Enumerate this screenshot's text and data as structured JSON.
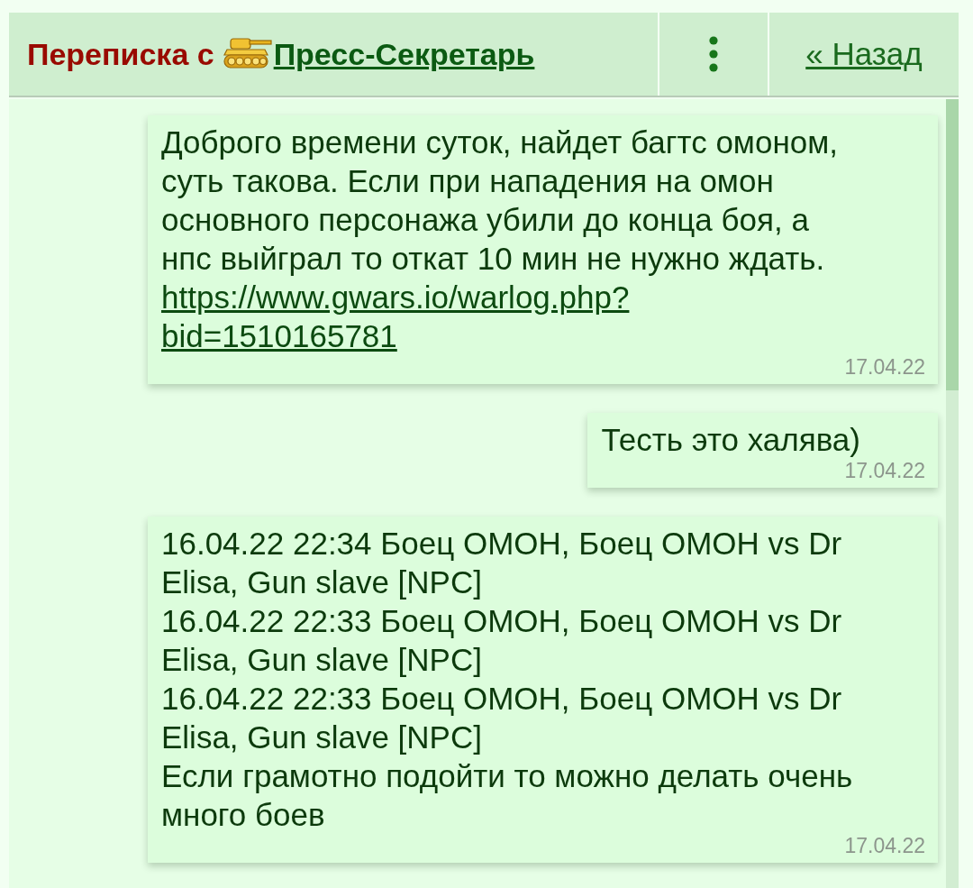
{
  "header": {
    "title": "Переписка с",
    "contact": "Пресс-Секретарь",
    "back": "« Назад"
  },
  "messages": [
    {
      "text": "Доброго времени суток, найдет багтс омоном, суть такова. Если при нападения на омон основного персонажа убили до конца боя, а нпс выйграл то откат 10 мин не нужно ждать.",
      "link": "https://www.gwars.io/warlog.php?bid=1510165781",
      "date": "17.04.22"
    },
    {
      "text": "Тесть это халява)",
      "date": "17.04.22"
    },
    {
      "text": "16.04.22 22:34 Боец ОМОН, Боец ОМОН vs Dr Elisa, Gun slave [NPC]\n16.04.22 22:33 Боец ОМОН, Боец ОМОН vs Dr Elisa, Gun slave [NPC]\n16.04.22 22:33 Боец ОМОН, Боец ОМОН vs Dr Elisa, Gun slave [NPC]\nЕсли грамотно подойти то можно делать очень много боев",
      "date": "17.04.22"
    }
  ]
}
